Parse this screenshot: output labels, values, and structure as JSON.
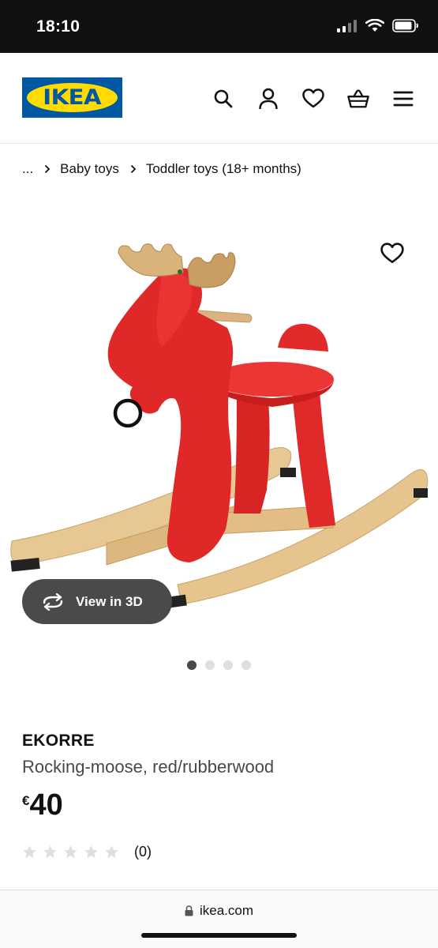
{
  "status_bar": {
    "time": "18:10",
    "icons": [
      "cellular-signal-icon",
      "wifi-icon",
      "battery-icon"
    ]
  },
  "header": {
    "logo_text": "IKEA",
    "icons": [
      "search-icon",
      "account-icon",
      "wishlist-heart-icon",
      "shopping-basket-icon",
      "menu-icon"
    ],
    "brand_colors": {
      "blue": "#0058a3",
      "yellow": "#ffdb00"
    }
  },
  "breadcrumb": {
    "ellipsis": "...",
    "items": [
      "Baby toys",
      "Toddler toys (18+ months)"
    ]
  },
  "gallery": {
    "view_3d_label": "View in 3D",
    "image_count": 4,
    "active_index": 0
  },
  "product": {
    "name": "EKORRE",
    "description": "Rocking-moose, red/rubberwood",
    "currency": "€",
    "price": "40",
    "rating_stars": 0,
    "rating_max": 5,
    "rating_count": "(0)"
  },
  "browser": {
    "url": "ikea.com"
  }
}
